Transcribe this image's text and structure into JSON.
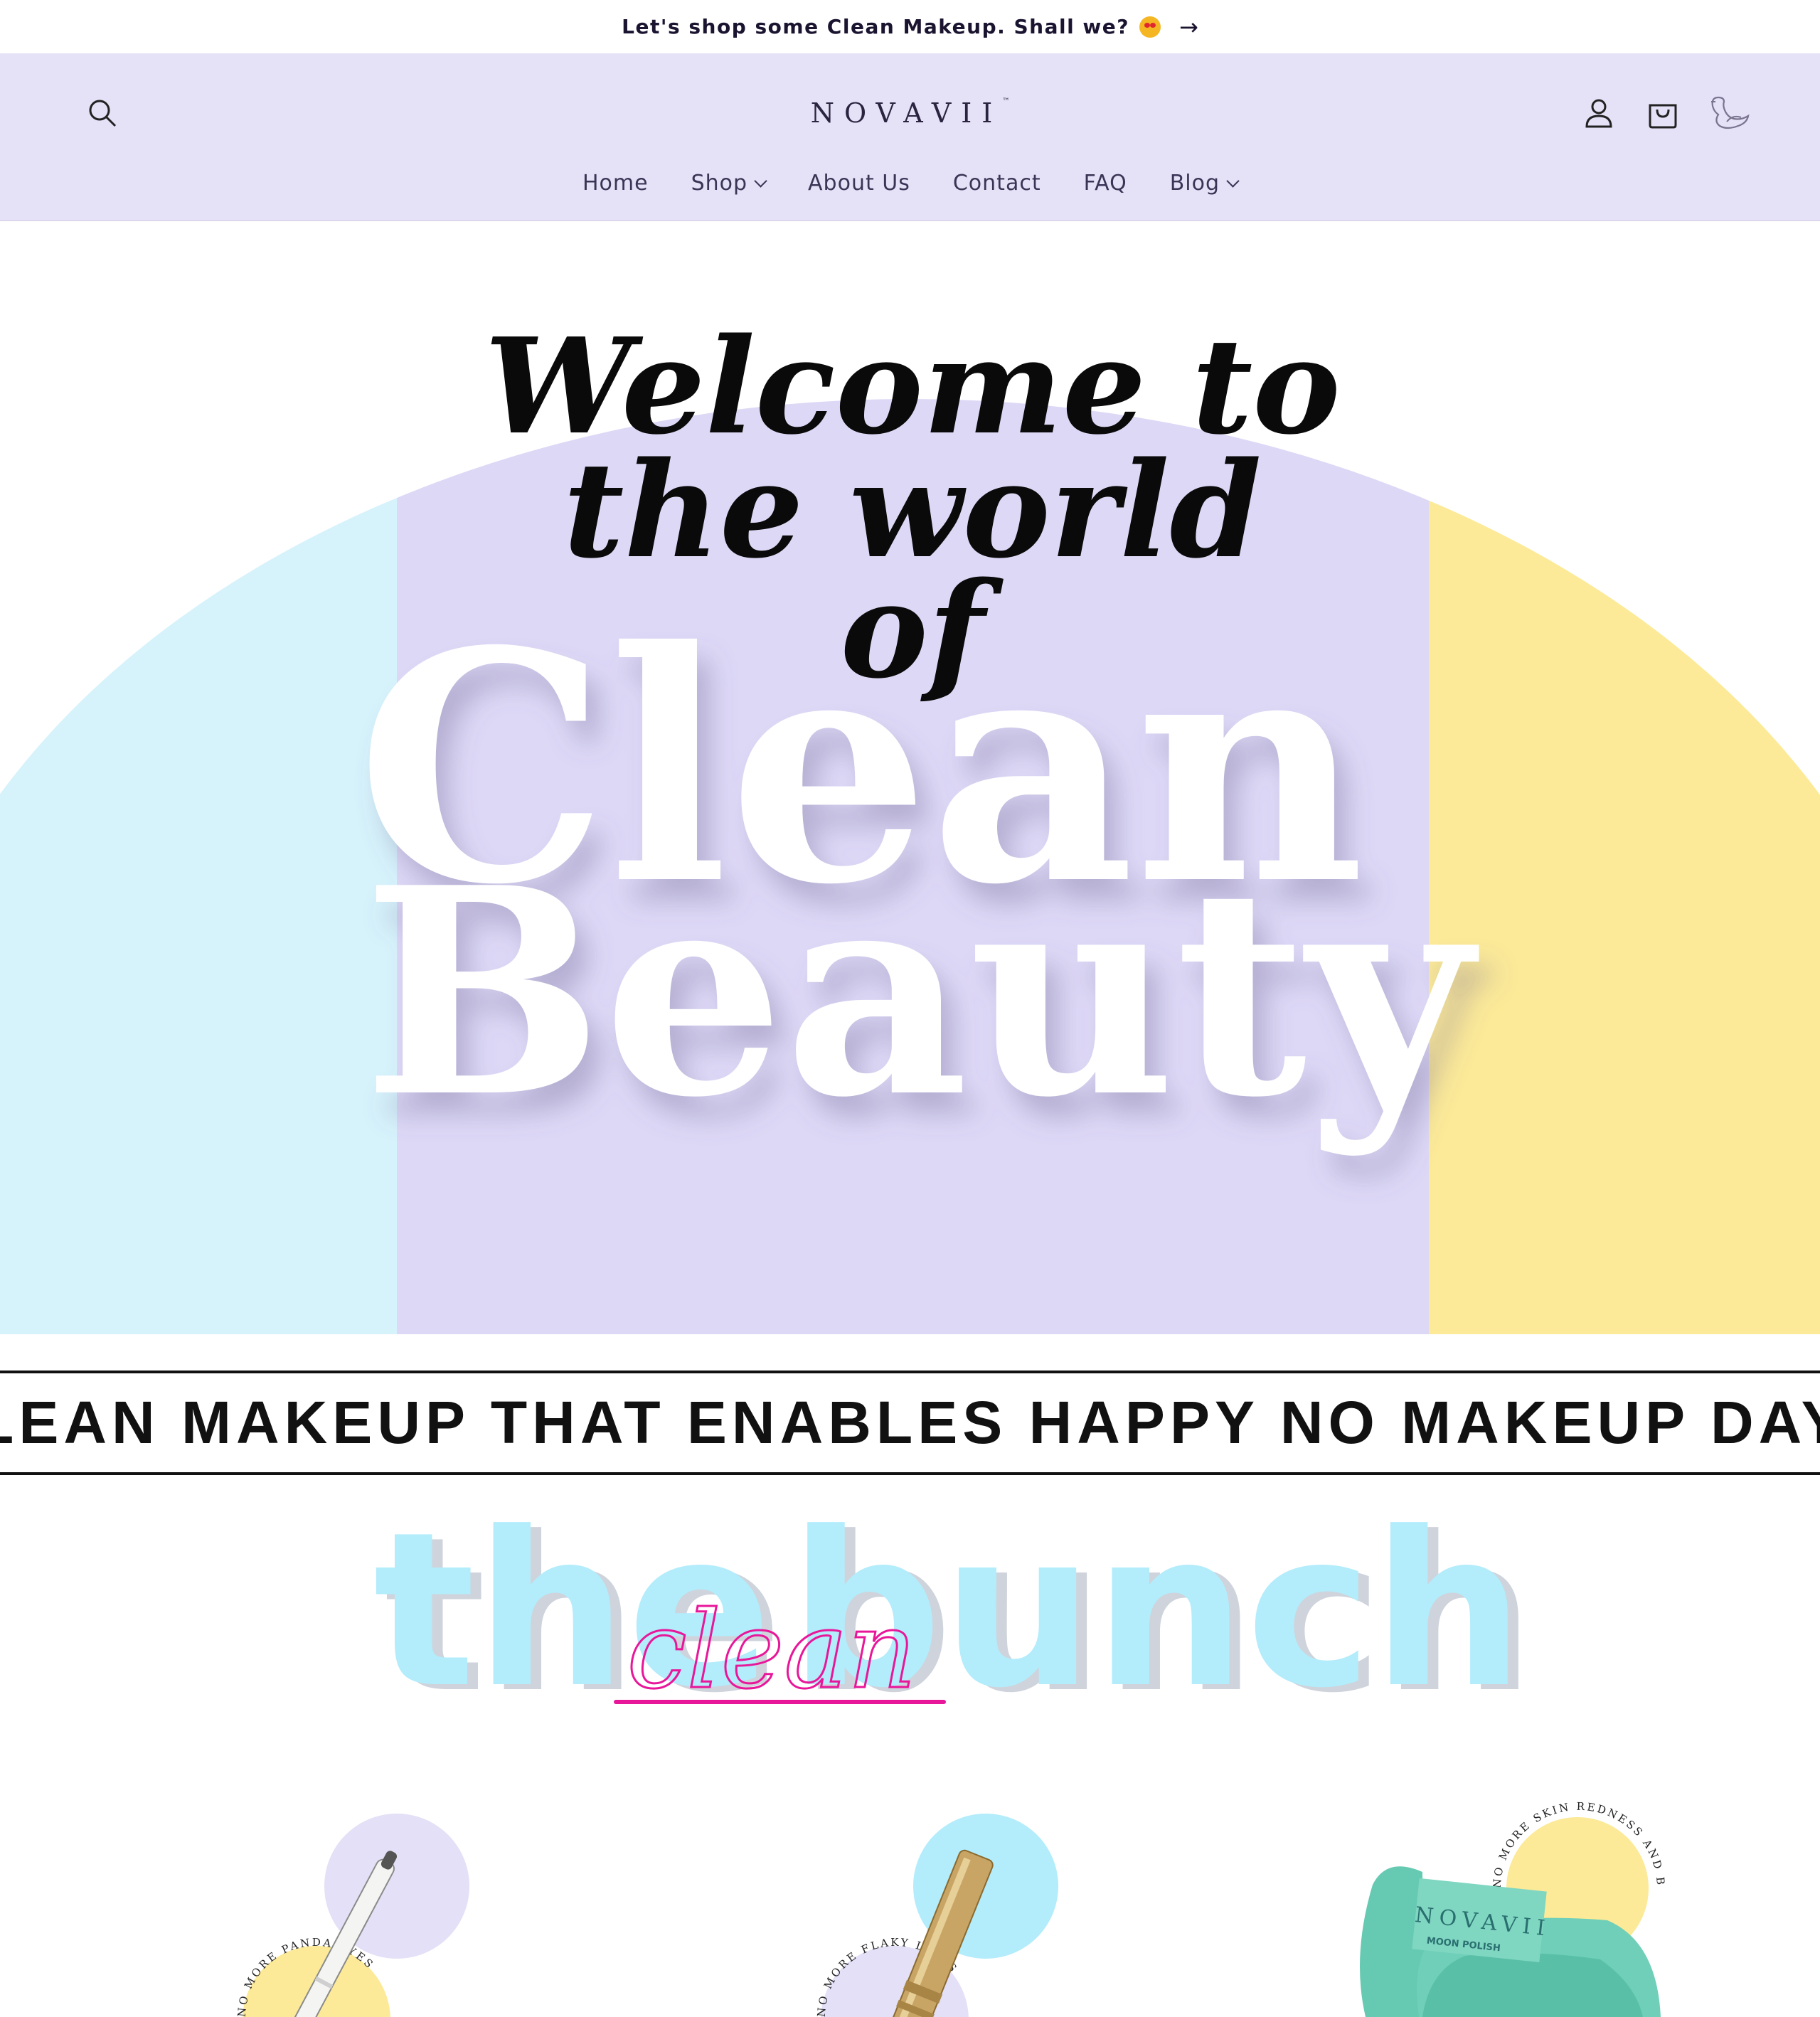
{
  "announcement": {
    "text": "Let's shop some Clean Makeup. Shall we?",
    "arrow": "→",
    "emoji_icon": "star-struck-emoji-icon"
  },
  "header": {
    "logo": "NOVAVII",
    "logo_mark": "™",
    "icons": [
      "search-icon",
      "account-icon",
      "cart-icon",
      "swan-icon"
    ],
    "nav": [
      {
        "label": "Home",
        "has_dropdown": false
      },
      {
        "label": "Shop",
        "has_dropdown": true
      },
      {
        "label": "About Us",
        "has_dropdown": false
      },
      {
        "label": "Contact",
        "has_dropdown": false
      },
      {
        "label": "FAQ",
        "has_dropdown": false
      },
      {
        "label": "Blog",
        "has_dropdown": true
      }
    ]
  },
  "hero": {
    "line1": "Welcome to",
    "line2": "the world",
    "line3": "of",
    "big1": "Clean",
    "big2": "Beauty",
    "colors": {
      "left": "#d6f2fb",
      "center": "#ddd8f6",
      "right": "#fcea98"
    }
  },
  "band": {
    "text": "CLEAN MAKEUP THAT ENABLES HAPPY NO MAKEUP DAYS"
  },
  "bunch": {
    "word1": "the",
    "word2": "bunch",
    "script": "clean",
    "colors": {
      "block": "#b3ecfb",
      "script": "#e8179a"
    }
  },
  "products": [
    {
      "name": "eyeliner-pencil",
      "badge": "NO MORE PANDA EYES",
      "circle_color": "#e3e0f7"
    },
    {
      "name": "lip-tube",
      "badge": "NO MORE FLAKY LINES",
      "circle_color": "#b3ecfb"
    },
    {
      "name": "moon-polish-towel",
      "badge": "NO MORE SKIN REDNESS AND BURNS",
      "product_logo": "NOVAVII",
      "product_sub": "MOON POLISH",
      "circle_color": "#fcea98"
    }
  ]
}
